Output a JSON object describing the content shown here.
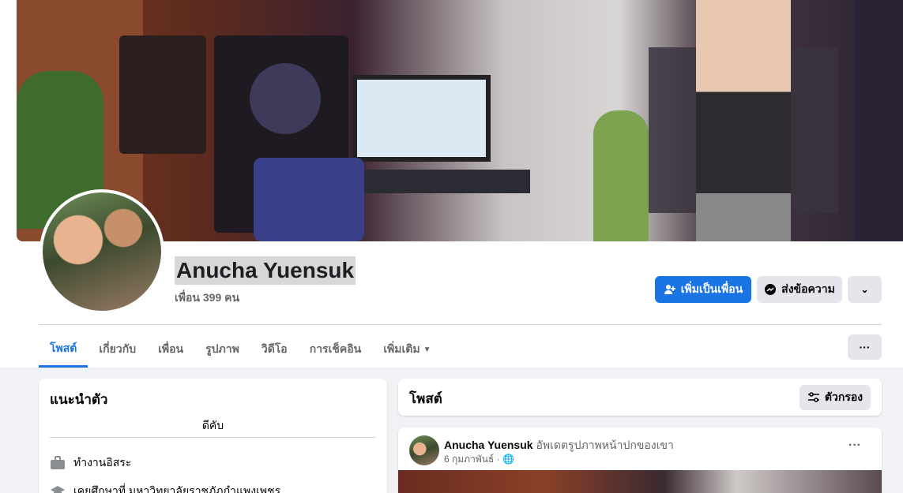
{
  "profile": {
    "name": "Anucha Yuensuk",
    "friends": "เพื่อน 399 คน"
  },
  "actions": {
    "add_friend": "เพิ่มเป็นเพื่อน",
    "message": "ส่งข้อความ"
  },
  "tabs": [
    {
      "label": "โพสต์"
    },
    {
      "label": "เกี่ยวกับ"
    },
    {
      "label": "เพื่อน"
    },
    {
      "label": "รูปภาพ"
    },
    {
      "label": "วิดีโอ"
    },
    {
      "label": "การเช็คอิน"
    },
    {
      "label": "เพิ่มเติม"
    }
  ],
  "intro": {
    "title": "แนะนำตัว",
    "bio": "ดีคับ",
    "work": "ทำงานอิสระ",
    "education": "เคยศึกษาที่ มหาวิทยาลัยราชภัฏกำแพงเพชร"
  },
  "posts": {
    "title": "โพสต์",
    "filter": "ตัวกรอง"
  },
  "post": {
    "author": "Anucha Yuensuk",
    "action": "อัพเดตรูปภาพหน้าปกของเขา",
    "date": "6 กุมภาพันธ์ ·"
  },
  "colors": {
    "accent": "#1b74e4",
    "bg": "#f0f2f5"
  }
}
